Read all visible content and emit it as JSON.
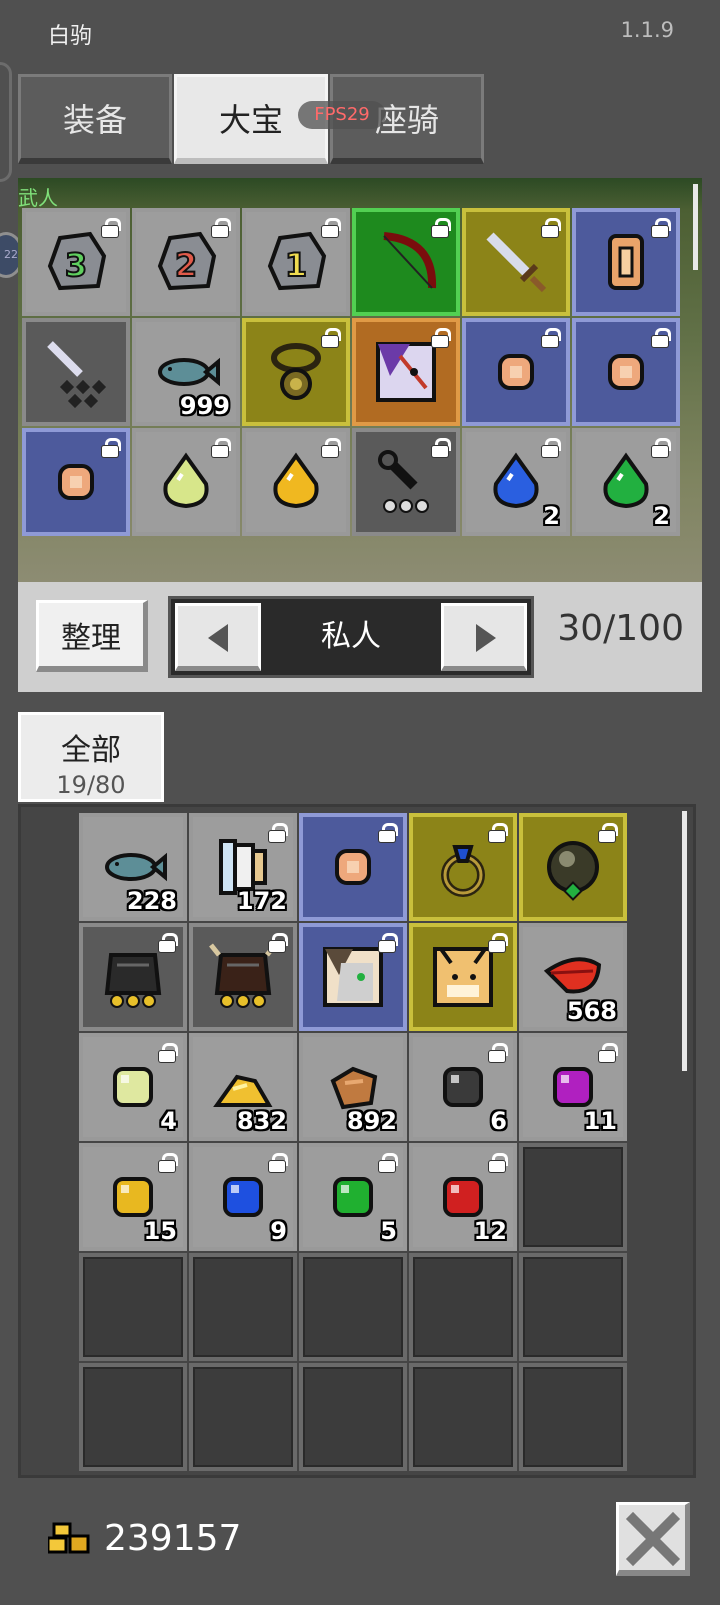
{
  "header": {
    "player_name": "白驹",
    "version": "1.1.9"
  },
  "tabs": [
    {
      "label": "装备",
      "active": false
    },
    {
      "label": "大宝",
      "active": true
    },
    {
      "label": "座骑",
      "active": false
    }
  ],
  "fps_label": "FPS29",
  "vault": {
    "banner": "武人",
    "rows": [
      [
        {
          "icon": "stone-3-icon",
          "rarity": "gray",
          "locked": true,
          "count": null
        },
        {
          "icon": "stone-2-icon",
          "rarity": "gray",
          "locked": true,
          "count": null
        },
        {
          "icon": "stone-1-icon",
          "rarity": "gray",
          "locked": true,
          "count": null
        },
        {
          "icon": "bow-icon",
          "rarity": "green",
          "locked": true,
          "count": null
        },
        {
          "icon": "sword-icon",
          "rarity": "yellow",
          "locked": true,
          "count": null
        },
        {
          "icon": "scroll-icon",
          "rarity": "blue",
          "locked": true,
          "count": null
        }
      ],
      [
        {
          "icon": "dagger-icon",
          "rarity": "dark",
          "locked": false,
          "count": null
        },
        {
          "icon": "fish-icon",
          "rarity": "gray",
          "locked": false,
          "count": "999"
        },
        {
          "icon": "amulet-icon",
          "rarity": "yellow",
          "locked": true,
          "count": null
        },
        {
          "icon": "pet-portrait-icon",
          "rarity": "orange",
          "locked": true,
          "count": null
        },
        {
          "icon": "coin-icon",
          "rarity": "blue",
          "locked": true,
          "count": null
        },
        {
          "icon": "coin-icon",
          "rarity": "blue",
          "locked": true,
          "count": null
        }
      ],
      [
        {
          "icon": "coin-icon",
          "rarity": "blue",
          "locked": true,
          "count": null
        },
        {
          "icon": "lime-drop-icon",
          "rarity": "gray",
          "locked": true,
          "count": null
        },
        {
          "icon": "gold-drop-icon",
          "rarity": "gray",
          "locked": true,
          "count": null
        },
        {
          "icon": "mace-icon",
          "rarity": "dark",
          "locked": true,
          "count": null
        },
        {
          "icon": "blue-drop-icon",
          "rarity": "gray",
          "locked": true,
          "count": "2"
        },
        {
          "icon": "green-drop-icon",
          "rarity": "gray",
          "locked": true,
          "count": "2"
        }
      ]
    ]
  },
  "controls": {
    "sort_label": "整理",
    "page_name": "私人",
    "capacity": "30/100"
  },
  "category": {
    "label": "全部",
    "count": "19/80"
  },
  "bag": {
    "rows": [
      [
        {
          "icon": "fish-icon",
          "rarity": "gray",
          "locked": false,
          "count": "228"
        },
        {
          "icon": "scroll-book-icon",
          "rarity": "gray",
          "locked": true,
          "count": "172"
        },
        {
          "icon": "coin-icon",
          "rarity": "blue",
          "locked": true,
          "count": null
        },
        {
          "icon": "sapphire-ring-icon",
          "rarity": "yellow",
          "locked": true,
          "count": null
        },
        {
          "icon": "dark-orb-icon",
          "rarity": "yellow",
          "locked": true,
          "count": null
        }
      ],
      [
        {
          "icon": "dark-armor-icon",
          "rarity": "dark",
          "locked": true,
          "count": null
        },
        {
          "icon": "horned-helm-icon",
          "rarity": "dark",
          "locked": true,
          "count": null
        },
        {
          "icon": "wolf-portrait-icon",
          "rarity": "blue",
          "locked": true,
          "count": null
        },
        {
          "icon": "cat-portrait-icon",
          "rarity": "yellow",
          "locked": true,
          "count": null
        },
        {
          "icon": "red-feather-icon",
          "rarity": "gray",
          "locked": false,
          "count": "568"
        }
      ],
      [
        {
          "icon": "lime-gem-icon",
          "rarity": "gray",
          "locked": true,
          "count": "4"
        },
        {
          "icon": "gold-pile-icon",
          "rarity": "gray",
          "locked": false,
          "count": "832"
        },
        {
          "icon": "copper-ore-icon",
          "rarity": "gray",
          "locked": false,
          "count": "892"
        },
        {
          "icon": "black-gem-icon",
          "rarity": "gray",
          "locked": true,
          "count": "6"
        },
        {
          "icon": "purple-gem-icon",
          "rarity": "gray",
          "locked": true,
          "count": "11"
        }
      ],
      [
        {
          "icon": "yellow-gem-icon",
          "rarity": "gray",
          "locked": true,
          "count": "15"
        },
        {
          "icon": "blue-gem-icon",
          "rarity": "gray",
          "locked": true,
          "count": "9"
        },
        {
          "icon": "green-gem-icon",
          "rarity": "gray",
          "locked": true,
          "count": "5"
        },
        {
          "icon": "red-gem-icon",
          "rarity": "gray",
          "locked": true,
          "count": "12"
        },
        {
          "icon": "empty-slot",
          "rarity": "empty",
          "locked": false,
          "count": null
        }
      ],
      [
        {
          "icon": "empty-slot",
          "rarity": "empty",
          "locked": false,
          "count": null
        },
        {
          "icon": "empty-slot",
          "rarity": "empty",
          "locked": false,
          "count": null
        },
        {
          "icon": "empty-slot",
          "rarity": "empty",
          "locked": false,
          "count": null
        },
        {
          "icon": "empty-slot",
          "rarity": "empty",
          "locked": false,
          "count": null
        },
        {
          "icon": "empty-slot",
          "rarity": "empty",
          "locked": false,
          "count": null
        }
      ],
      [
        {
          "icon": "empty-slot",
          "rarity": "empty",
          "locked": false,
          "count": null
        },
        {
          "icon": "empty-slot",
          "rarity": "empty",
          "locked": false,
          "count": null
        },
        {
          "icon": "empty-slot",
          "rarity": "empty",
          "locked": false,
          "count": null
        },
        {
          "icon": "empty-slot",
          "rarity": "empty",
          "locked": false,
          "count": null
        },
        {
          "icon": "empty-slot",
          "rarity": "empty",
          "locked": false,
          "count": null
        }
      ]
    ]
  },
  "footer": {
    "gold_amount": "239157"
  },
  "colors": {
    "background": "#505050",
    "panel": "#cfcfcf",
    "fps": "#ff6a6a"
  }
}
